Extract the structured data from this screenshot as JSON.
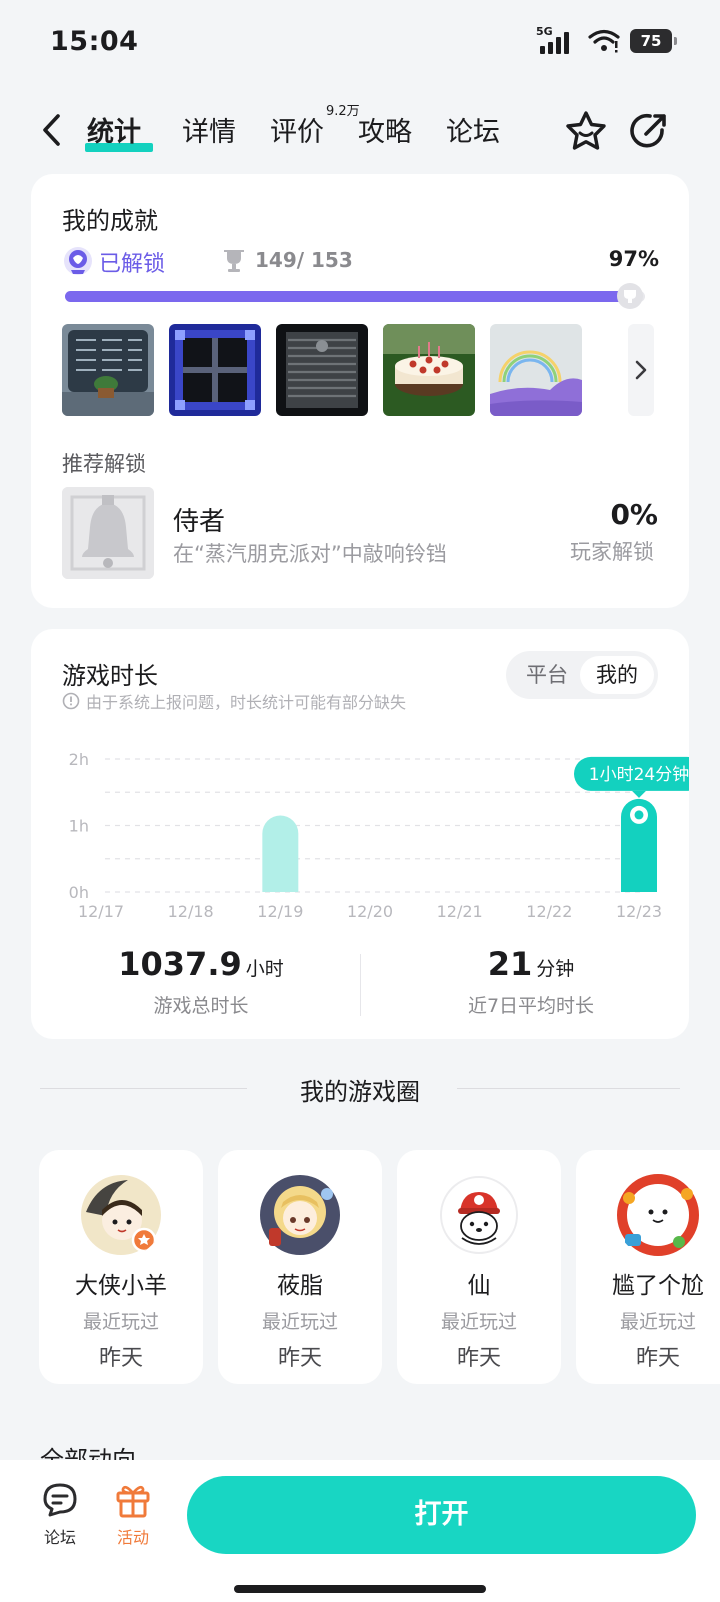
{
  "status_bar": {
    "time": "15:04",
    "network": "5G",
    "battery": "75"
  },
  "nav": {
    "tabs": [
      {
        "label": "统计",
        "active": true
      },
      {
        "label": "详情",
        "active": false
      },
      {
        "label": "评价",
        "active": false
      },
      {
        "label": "攻略",
        "active": false
      },
      {
        "label": "论坛",
        "active": false
      }
    ],
    "review_count_badge": "9.2万",
    "accent_color": "#13d1bf"
  },
  "achievements": {
    "title": "我的成就",
    "unlocked_label": "已解锁",
    "unlocked_count": "149/ 153",
    "percent": "97%",
    "progress_fraction": 0.97,
    "thumbnails": [
      {
        "name": "vent-window-plant"
      },
      {
        "name": "blue-frame-window"
      },
      {
        "name": "dark-shutter"
      },
      {
        "name": "birthday-cake"
      },
      {
        "name": "rainbow-scene"
      }
    ],
    "recommended_label": "推荐解锁",
    "recommended": {
      "name": "侍者",
      "description": "在“蒸汽朋克派对”中敲响铃铛",
      "percent": "0%",
      "percent_label": "玩家解锁"
    }
  },
  "playtime": {
    "title": "游戏时长",
    "toggle": {
      "platform": "平台",
      "mine": "我的",
      "selected": "mine"
    },
    "note": "由于系统上报问题，时长统计可能有部分缺失",
    "total_value": "1037.9",
    "total_unit": "小时",
    "total_label": "游戏总时长",
    "avg_value": "21",
    "avg_unit": "分钟",
    "avg_label": "近7日平均时长",
    "tooltip": "1小时24分钟"
  },
  "chart_data": {
    "type": "bar",
    "categories": [
      "12/17",
      "12/18",
      "12/19",
      "12/20",
      "12/21",
      "12/22",
      "12/23"
    ],
    "values": [
      0,
      0,
      1.15,
      0,
      0,
      0,
      1.4
    ],
    "unit": "h",
    "ylim": [
      0,
      2
    ],
    "yticks": [
      "0h",
      "1h",
      "2h"
    ],
    "highlight_index": 6,
    "highlight_label": "1小时24分钟",
    "colors": {
      "bar": "#b2efe8",
      "highlight": "#13d1bf"
    },
    "grid": true
  },
  "circle": {
    "title": "我的游戏圈",
    "recent_label": "最近玩过",
    "members": [
      {
        "name": "大侠小羊",
        "last_played": "昨天",
        "avatar": "chibi-ink-avatar"
      },
      {
        "name": "莜脂",
        "last_played": "昨天",
        "avatar": "blonde-girl-avatar"
      },
      {
        "name": "仙",
        "last_played": "昨天",
        "avatar": "red-cap-bear-avatar"
      },
      {
        "name": "尴了个尬",
        "last_played": "昨天",
        "avatar": "festive-ring-avatar"
      }
    ]
  },
  "feed": {
    "title": "全部动向"
  },
  "bottom_bar": {
    "forum": "论坛",
    "activity": "活动",
    "open": "打开"
  }
}
